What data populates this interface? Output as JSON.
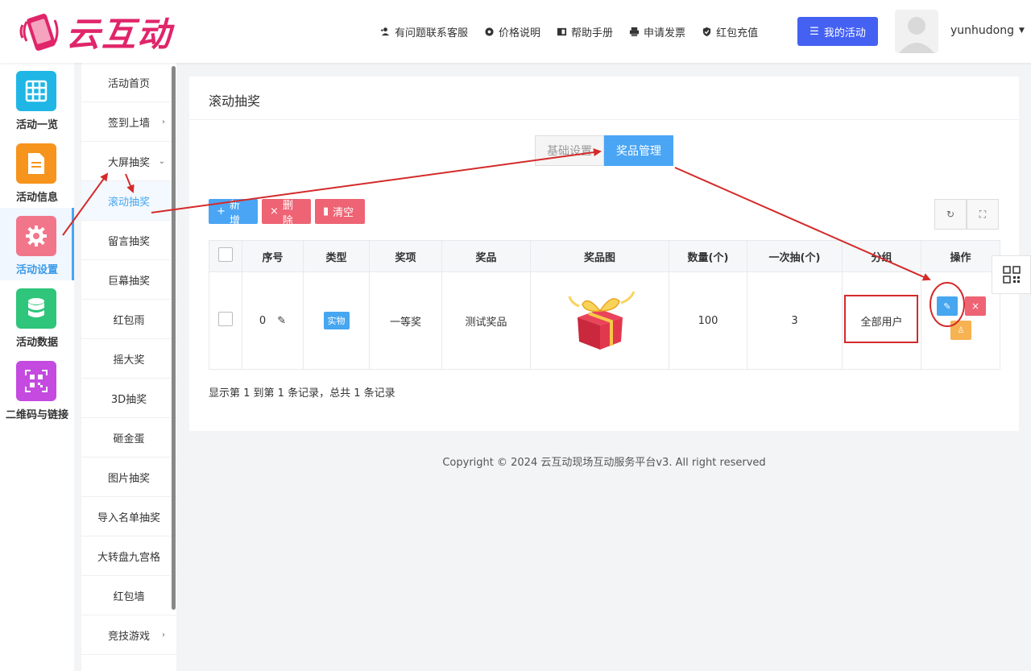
{
  "brand": {
    "name": "云互动",
    "color": "#e0256a"
  },
  "topnav": [
    {
      "icon": "user-plus-icon",
      "label": "有问题联系客服"
    },
    {
      "icon": "gear-icon",
      "label": "价格说明"
    },
    {
      "icon": "book-icon",
      "label": "帮助手册"
    },
    {
      "icon": "printer-icon",
      "label": "申请发票"
    },
    {
      "icon": "shield-check-icon",
      "label": "红包充值"
    }
  ],
  "my_activity_label": "我的活动",
  "username": "yunhudong",
  "iconbar": [
    {
      "label": "活动一览",
      "color": "#1fb6e6",
      "icon": "grid-icon"
    },
    {
      "label": "活动信息",
      "color": "#f7941d",
      "icon": "document-icon"
    },
    {
      "label": "活动设置",
      "color": "#f2768a",
      "icon": "gear-icon"
    },
    {
      "label": "活动数据",
      "color": "#2fc57a",
      "icon": "database-icon"
    },
    {
      "label": "二维码与链接",
      "color": "#c44ae0",
      "icon": "qrcode-icon"
    }
  ],
  "subnav": [
    {
      "label": "活动首页"
    },
    {
      "label": "签到上墙",
      "arrow": "›"
    },
    {
      "label": "大屏抽奖",
      "arrow": "⌄"
    },
    {
      "label": "滚动抽奖"
    },
    {
      "label": "留言抽奖"
    },
    {
      "label": "巨幕抽奖"
    },
    {
      "label": "红包雨"
    },
    {
      "label": "摇大奖"
    },
    {
      "label": "3D抽奖"
    },
    {
      "label": "砸金蛋"
    },
    {
      "label": "图片抽奖"
    },
    {
      "label": "导入名单抽奖"
    },
    {
      "label": "大转盘九宫格"
    },
    {
      "label": "红包墙"
    },
    {
      "label": "竞技游戏",
      "arrow": "›"
    }
  ],
  "page_title": "滚动抽奖",
  "tabs": [
    {
      "label": "基础设置"
    },
    {
      "label": "奖品管理"
    }
  ],
  "toolbar": {
    "add": "新增",
    "delete": "删除",
    "clear": "清空"
  },
  "table": {
    "headers": [
      "序号",
      "类型",
      "奖项",
      "奖品",
      "奖品图",
      "数量(个)",
      "一次抽(个)",
      "分组",
      "操作"
    ],
    "rows": [
      {
        "index": "0",
        "type": "实物",
        "award": "一等奖",
        "prize": "测试奖品",
        "image": "gift-box",
        "quantity": "100",
        "per_draw": "3",
        "group": "全部用户"
      }
    ]
  },
  "pager": "显示第 1 到第 1 条记录，总共 1 条记录",
  "footer": "Copyright © 2024 云互动现场互动服务平台v3. All right reserved",
  "annotation_color": "#d42a2a"
}
